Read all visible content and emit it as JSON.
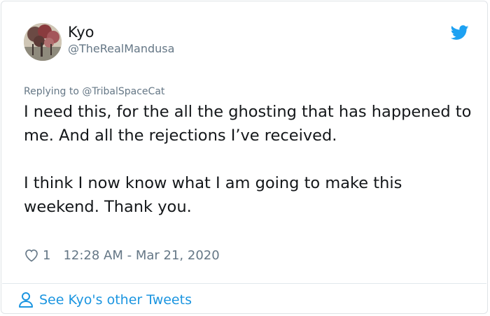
{
  "author": {
    "name": "Kyo",
    "handle": "@TheRealMandusa",
    "avatar_icon": "avatar-photo"
  },
  "brand": {
    "icon": "twitter-bird-icon",
    "color": "#1da1f2"
  },
  "reply": {
    "prefix": "Replying to ",
    "mention": "@TribalSpaceCat"
  },
  "tweet": {
    "text": "I need this, for the all the ghosting that has happened to me. And all the rejections I’ve received.\n\nI think I now know what I am going to make this weekend. Thank you."
  },
  "meta": {
    "like_icon": "heart-icon",
    "likes": "1",
    "timestamp": "12:28 AM - Mar 21, 2020"
  },
  "footer": {
    "icon": "person-icon",
    "link_label": "See Kyo's other Tweets",
    "link_color": "#1b95e0"
  }
}
